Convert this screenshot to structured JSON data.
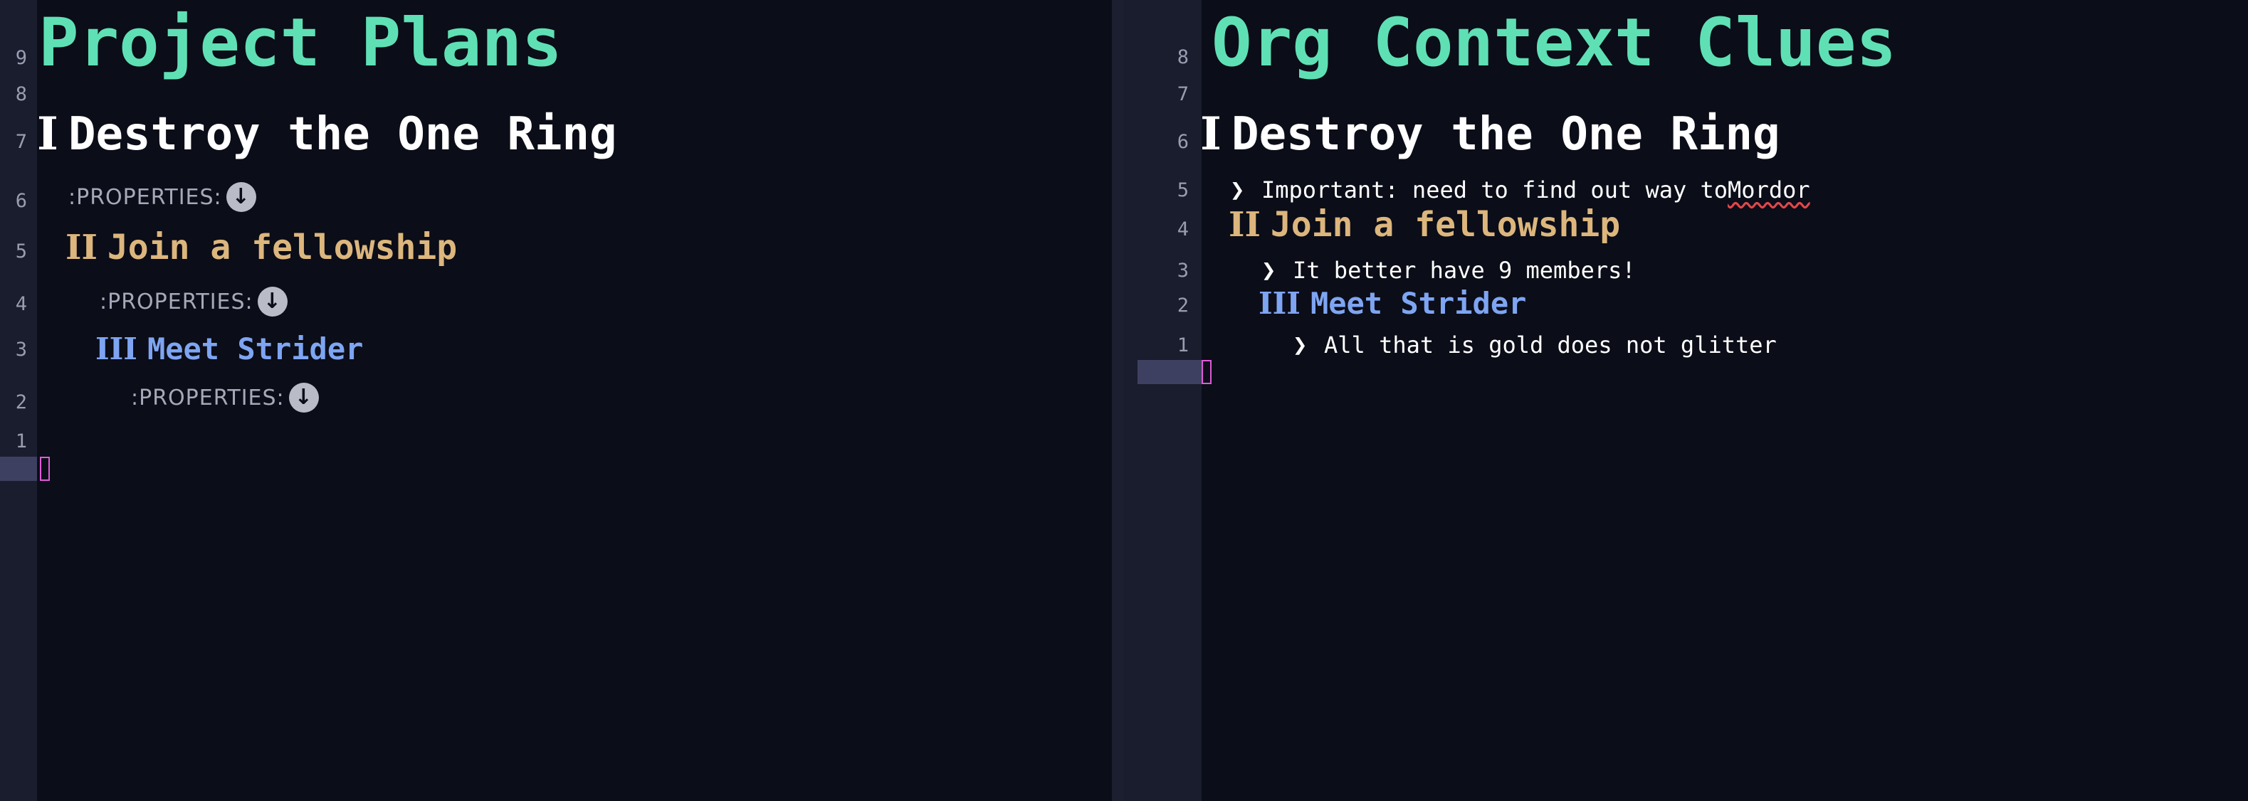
{
  "left": {
    "title": "Project Plans",
    "line_numbers": [
      "9",
      "8",
      "7",
      "6",
      "5",
      "4",
      "3",
      "2",
      "1"
    ],
    "heading1": {
      "roman": "I",
      "text": "Destroy the One Ring"
    },
    "heading2": {
      "roman": "II",
      "text": "Join a fellowship"
    },
    "heading3": {
      "roman": "III",
      "text": "Meet Strider"
    },
    "properties_label": ":PROPERTIES:",
    "properties_icon": "arrow-down-circle-icon"
  },
  "right": {
    "title": "Org Context Clues",
    "line_numbers": [
      "8",
      "7",
      "6",
      "5",
      "4",
      "3",
      "2",
      "1"
    ],
    "heading1": {
      "roman": "I",
      "text": "Destroy the One Ring"
    },
    "clue1": {
      "prefix": "Important: need to find out way to ",
      "link": "Mordor"
    },
    "heading2": {
      "roman": "II",
      "text": "Join a fellowship"
    },
    "clue2": "It better have 9 members!",
    "heading3": {
      "roman": "III",
      "text": "Meet Strider"
    },
    "clue3": "All that is gold does not glitter",
    "chevron_icon": "chevron-right-icon"
  },
  "colors": {
    "background": "#0b0d18",
    "title": "#5fe0b4",
    "heading1": "#ffffff",
    "heading2": "#dcb67d",
    "heading3": "#7ea5f2",
    "cursor": "#e05ad8"
  }
}
